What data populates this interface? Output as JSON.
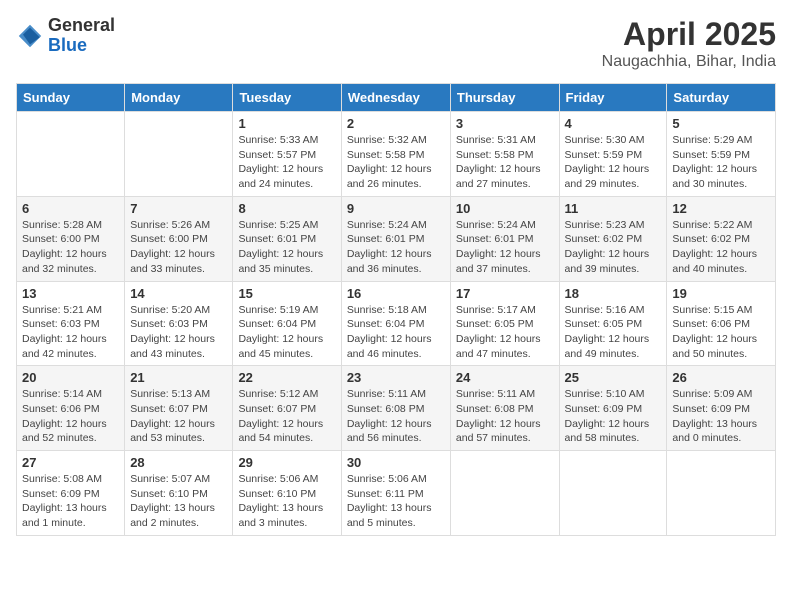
{
  "header": {
    "logo_general": "General",
    "logo_blue": "Blue",
    "month_title": "April 2025",
    "location": "Naugachhia, Bihar, India"
  },
  "days_of_week": [
    "Sunday",
    "Monday",
    "Tuesday",
    "Wednesday",
    "Thursday",
    "Friday",
    "Saturday"
  ],
  "weeks": [
    [
      {
        "day": "",
        "info": ""
      },
      {
        "day": "",
        "info": ""
      },
      {
        "day": "1",
        "info": "Sunrise: 5:33 AM\nSunset: 5:57 PM\nDaylight: 12 hours and 24 minutes."
      },
      {
        "day": "2",
        "info": "Sunrise: 5:32 AM\nSunset: 5:58 PM\nDaylight: 12 hours and 26 minutes."
      },
      {
        "day": "3",
        "info": "Sunrise: 5:31 AM\nSunset: 5:58 PM\nDaylight: 12 hours and 27 minutes."
      },
      {
        "day": "4",
        "info": "Sunrise: 5:30 AM\nSunset: 5:59 PM\nDaylight: 12 hours and 29 minutes."
      },
      {
        "day": "5",
        "info": "Sunrise: 5:29 AM\nSunset: 5:59 PM\nDaylight: 12 hours and 30 minutes."
      }
    ],
    [
      {
        "day": "6",
        "info": "Sunrise: 5:28 AM\nSunset: 6:00 PM\nDaylight: 12 hours and 32 minutes."
      },
      {
        "day": "7",
        "info": "Sunrise: 5:26 AM\nSunset: 6:00 PM\nDaylight: 12 hours and 33 minutes."
      },
      {
        "day": "8",
        "info": "Sunrise: 5:25 AM\nSunset: 6:01 PM\nDaylight: 12 hours and 35 minutes."
      },
      {
        "day": "9",
        "info": "Sunrise: 5:24 AM\nSunset: 6:01 PM\nDaylight: 12 hours and 36 minutes."
      },
      {
        "day": "10",
        "info": "Sunrise: 5:24 AM\nSunset: 6:01 PM\nDaylight: 12 hours and 37 minutes."
      },
      {
        "day": "11",
        "info": "Sunrise: 5:23 AM\nSunset: 6:02 PM\nDaylight: 12 hours and 39 minutes."
      },
      {
        "day": "12",
        "info": "Sunrise: 5:22 AM\nSunset: 6:02 PM\nDaylight: 12 hours and 40 minutes."
      }
    ],
    [
      {
        "day": "13",
        "info": "Sunrise: 5:21 AM\nSunset: 6:03 PM\nDaylight: 12 hours and 42 minutes."
      },
      {
        "day": "14",
        "info": "Sunrise: 5:20 AM\nSunset: 6:03 PM\nDaylight: 12 hours and 43 minutes."
      },
      {
        "day": "15",
        "info": "Sunrise: 5:19 AM\nSunset: 6:04 PM\nDaylight: 12 hours and 45 minutes."
      },
      {
        "day": "16",
        "info": "Sunrise: 5:18 AM\nSunset: 6:04 PM\nDaylight: 12 hours and 46 minutes."
      },
      {
        "day": "17",
        "info": "Sunrise: 5:17 AM\nSunset: 6:05 PM\nDaylight: 12 hours and 47 minutes."
      },
      {
        "day": "18",
        "info": "Sunrise: 5:16 AM\nSunset: 6:05 PM\nDaylight: 12 hours and 49 minutes."
      },
      {
        "day": "19",
        "info": "Sunrise: 5:15 AM\nSunset: 6:06 PM\nDaylight: 12 hours and 50 minutes."
      }
    ],
    [
      {
        "day": "20",
        "info": "Sunrise: 5:14 AM\nSunset: 6:06 PM\nDaylight: 12 hours and 52 minutes."
      },
      {
        "day": "21",
        "info": "Sunrise: 5:13 AM\nSunset: 6:07 PM\nDaylight: 12 hours and 53 minutes."
      },
      {
        "day": "22",
        "info": "Sunrise: 5:12 AM\nSunset: 6:07 PM\nDaylight: 12 hours and 54 minutes."
      },
      {
        "day": "23",
        "info": "Sunrise: 5:11 AM\nSunset: 6:08 PM\nDaylight: 12 hours and 56 minutes."
      },
      {
        "day": "24",
        "info": "Sunrise: 5:11 AM\nSunset: 6:08 PM\nDaylight: 12 hours and 57 minutes."
      },
      {
        "day": "25",
        "info": "Sunrise: 5:10 AM\nSunset: 6:09 PM\nDaylight: 12 hours and 58 minutes."
      },
      {
        "day": "26",
        "info": "Sunrise: 5:09 AM\nSunset: 6:09 PM\nDaylight: 13 hours and 0 minutes."
      }
    ],
    [
      {
        "day": "27",
        "info": "Sunrise: 5:08 AM\nSunset: 6:09 PM\nDaylight: 13 hours and 1 minute."
      },
      {
        "day": "28",
        "info": "Sunrise: 5:07 AM\nSunset: 6:10 PM\nDaylight: 13 hours and 2 minutes."
      },
      {
        "day": "29",
        "info": "Sunrise: 5:06 AM\nSunset: 6:10 PM\nDaylight: 13 hours and 3 minutes."
      },
      {
        "day": "30",
        "info": "Sunrise: 5:06 AM\nSunset: 6:11 PM\nDaylight: 13 hours and 5 minutes."
      },
      {
        "day": "",
        "info": ""
      },
      {
        "day": "",
        "info": ""
      },
      {
        "day": "",
        "info": ""
      }
    ]
  ]
}
